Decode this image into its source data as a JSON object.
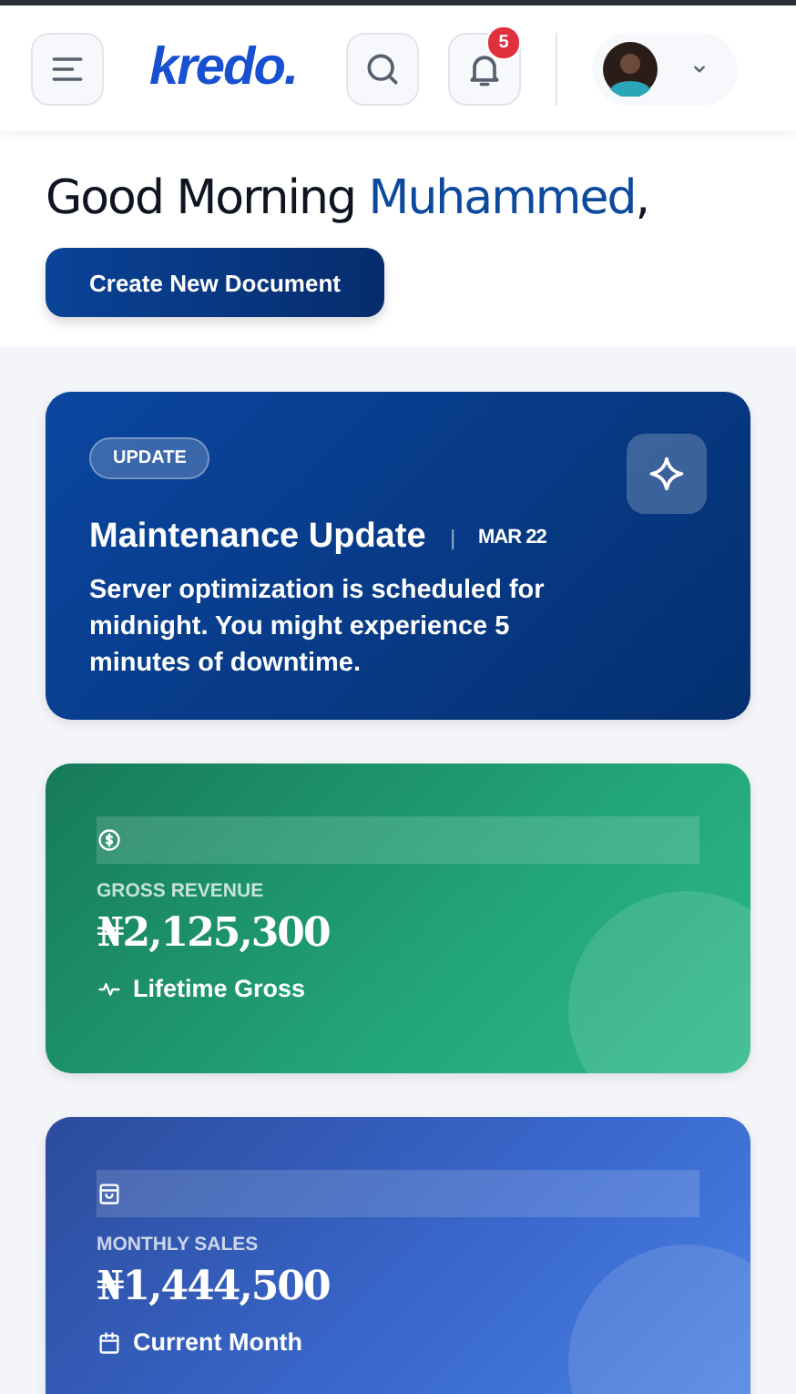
{
  "header": {
    "logo": "kredo.",
    "notifications": {
      "count": "5"
    }
  },
  "greeting": {
    "text": "Good Morning",
    "name": "Muhammed",
    "suffix": ","
  },
  "primary_action": "Create New Document",
  "announcement": {
    "tag": "UPDATE",
    "title": "Maintenance Update",
    "separator": "|",
    "date": "MAR 22",
    "body": "Server optimization is scheduled for midnight. You might experience 5 minutes of downtime."
  },
  "stats": [
    {
      "kind": "revenue",
      "label": "GROSS REVENUE",
      "value": "₦2,125,300",
      "footer": "Lifetime Gross"
    },
    {
      "kind": "sales",
      "label": "MONTHLY SALES",
      "value": "₦1,444,500",
      "footer": "Current Month"
    }
  ]
}
